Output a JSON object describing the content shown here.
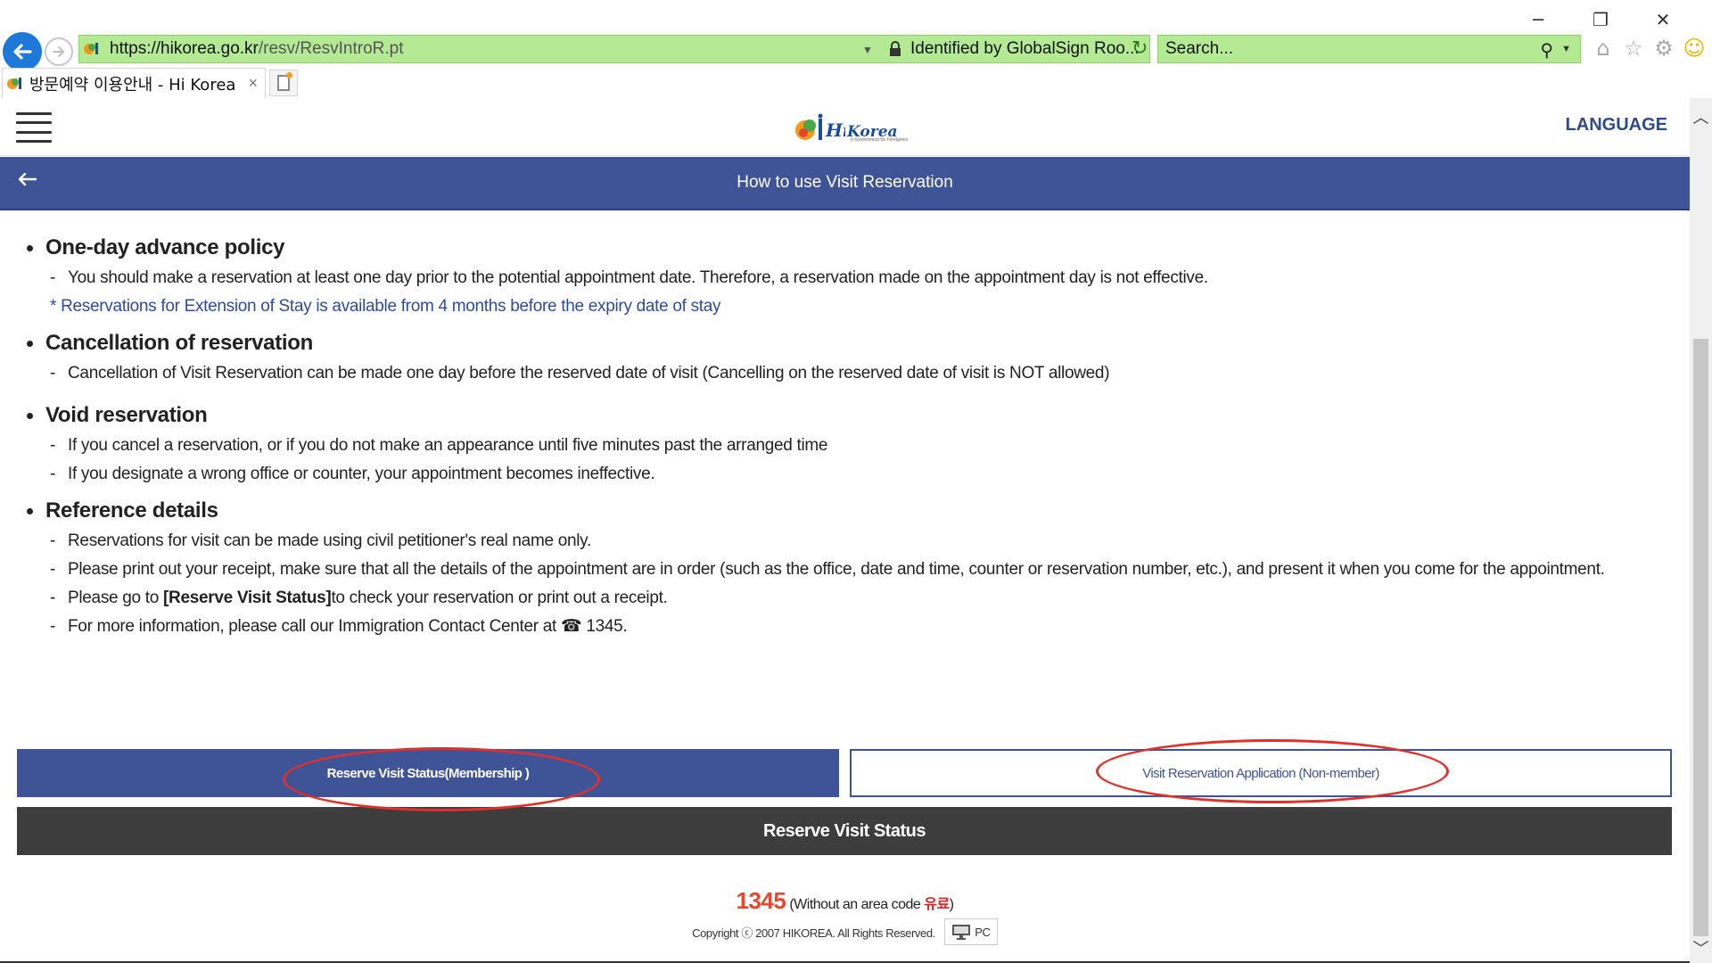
{
  "browser": {
    "url_host": "https://hikorea.go.kr",
    "url_path": "/resv/ResvIntroR.pt",
    "identity": "Identified by GlobalSign Roo...",
    "search_placeholder": "Search...",
    "tab_title": "방문예약 이용안내 - Hi Korea",
    "tab_close": "×",
    "win_minimize": "─",
    "win_restore": "❐",
    "win_close": "✕"
  },
  "header": {
    "logo_text": "Korea",
    "logo_sub": "e-Government for Foreigners",
    "language": "LANGUAGE"
  },
  "title_bar": {
    "title": "How to use Visit Reservation"
  },
  "sections": [
    {
      "heading": "One-day advance policy",
      "items": [
        "You should make a reservation at least one day prior to the potential appointment date. Therefore, a reservation made on the appointment day is not effective."
      ],
      "note": "* Reservations for Extension of Stay is available from 4 months before the expiry date of stay"
    },
    {
      "heading": "Cancellation of reservation",
      "items": [
        "Cancellation of Visit Reservation can be made one day before the reserved date of visit (Cancelling on the reserved date of visit is NOT allowed)"
      ]
    },
    {
      "heading": "Void reservation",
      "items": [
        "If you cancel a reservation, or if you do not make an appearance until five minutes past the arranged time",
        "If you designate a wrong office or counter, your appointment becomes ineffective."
      ]
    },
    {
      "heading": "Reference details",
      "items": [
        "Reservations for visit can be made using civil petitioner's real name only.",
        "Please print out your receipt, make sure that all the details of the appointment are in order (such as the office, date and time, counter or reservation number, etc.), and present it when you come for the appointment.",
        "Please go to ",
        "For more information, please call our Immigration Contact Center at ☎ 1345."
      ],
      "item3_bold": "[Reserve Visit Status]",
      "item3_rest": "to check your reservation or print out a receipt."
    }
  ],
  "buttons": {
    "member": "Reserve Visit Status(Membership )",
    "nonmember": "Visit Reservation Application (Non-member)",
    "status": "Reserve Visit Status"
  },
  "footer": {
    "phone": "1345",
    "note_prefix": "(Without an area code ",
    "note_red": "유료",
    "note_suffix": ")",
    "copyright": "Copyright ⓒ 2007 HIKOREA. All Rights Reserved.",
    "pc_label": "PC"
  },
  "colors": {
    "primary_blue": "#3f5496",
    "dark_button": "#3d3d3d",
    "note_blue": "#2e4b9c",
    "annotation_red": "#e0302a",
    "phone_orange": "#e8472e",
    "address_bar_green": "#b5ea95"
  },
  "icons": {
    "back": "arrow-left-icon",
    "forward": "arrow-right-icon",
    "lock": "lock-icon",
    "refresh": "refresh-icon",
    "search": "search-icon",
    "home": "home-icon",
    "favorites": "star-icon",
    "settings": "gear-icon",
    "feedback": "smiley-icon",
    "menu": "hamburger-icon",
    "monitor": "monitor-icon"
  }
}
